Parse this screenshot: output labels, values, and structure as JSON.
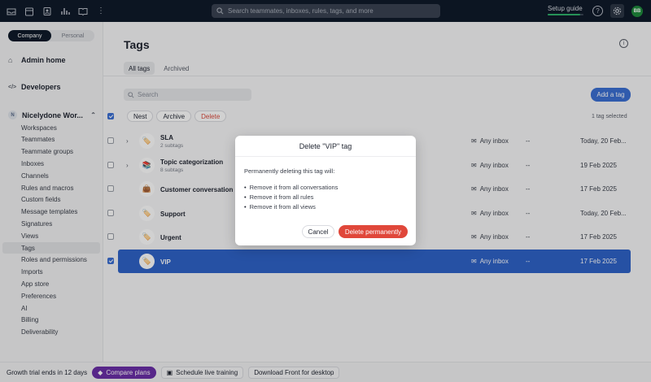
{
  "topbar": {
    "icons": [
      "inbox-icon",
      "calendar-icon",
      "contacts-icon",
      "analytics-icon",
      "knowledge-base-icon",
      "more-icon"
    ],
    "search_placeholder": "Search teammates, inboxes, rules, tags, and more",
    "setup_guide": "Setup guide",
    "setup_progress": 0.9,
    "avatar_initials": "BB"
  },
  "sidebar": {
    "segments": [
      "Company",
      "Personal"
    ],
    "admin_home": "Admin home",
    "developers": "Developers",
    "workspace_initial": "N",
    "workspace": "Nicelydone Wor...",
    "items": [
      "Workspaces",
      "Teammates",
      "Teammate groups",
      "Inboxes",
      "Channels",
      "Rules and macros",
      "Custom fields",
      "Message templates",
      "Signatures",
      "Views",
      "Tags",
      "Roles and permissions",
      "Imports",
      "App store",
      "Preferences",
      "AI",
      "Billing",
      "Deliverability"
    ],
    "active_item": "Tags"
  },
  "main": {
    "title": "Tags",
    "tabs": [
      "All tags",
      "Archived"
    ],
    "search_placeholder": "Search",
    "add_tag": "Add a tag",
    "actions": [
      "Nest",
      "Archive",
      "Delete"
    ],
    "selected_count": "1 tag selected",
    "rows": [
      {
        "name": "SLA",
        "sub": "2 subtags",
        "inbox": "Any inbox",
        "dash": "--",
        "date": "Today, 20 Feb...",
        "expandable": true,
        "emoji": "🏷️",
        "selected": false
      },
      {
        "name": "Topic categorization",
        "sub": "8 subtags",
        "inbox": "Any inbox",
        "dash": "--",
        "date": "19 Feb 2025",
        "expandable": true,
        "emoji": "📚",
        "selected": false
      },
      {
        "name": "Customer conversation",
        "sub": "",
        "inbox": "Any inbox",
        "dash": "--",
        "date": "17 Feb 2025",
        "expandable": false,
        "emoji": "👜",
        "selected": false
      },
      {
        "name": "Support",
        "sub": "",
        "inbox": "Any inbox",
        "dash": "--",
        "date": "Today, 20 Feb...",
        "expandable": false,
        "emoji": "🏷️",
        "selected": false
      },
      {
        "name": "Urgent",
        "sub": "",
        "inbox": "Any inbox",
        "dash": "--",
        "date": "17 Feb 2025",
        "expandable": false,
        "emoji": "🏷️",
        "selected": false
      },
      {
        "name": "VIP",
        "sub": "",
        "inbox": "Any inbox",
        "dash": "--",
        "date": "17 Feb 2025",
        "expandable": false,
        "emoji": "🏷️",
        "selected": true
      }
    ]
  },
  "footer": {
    "trial": "Growth trial ends in 12 days",
    "compare": "Compare plans",
    "schedule": "Schedule live training",
    "download": "Download Front for desktop"
  },
  "dialog": {
    "title": "Delete \"VIP\" tag",
    "intro": "Permanently deleting this tag will:",
    "bullets": [
      "Remove it from all conversations",
      "Remove it from all rules",
      "Remove it from all views"
    ],
    "cancel": "Cancel",
    "confirm": "Delete permanently"
  }
}
